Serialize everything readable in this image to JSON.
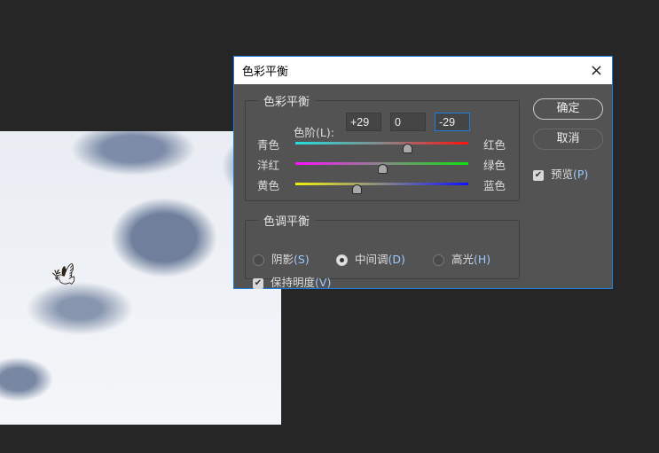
{
  "dialog": {
    "title": "色彩平衡",
    "close_icon": "×"
  },
  "color_balance": {
    "legend": "色彩平衡",
    "levels_label": "色阶",
    "levels_mnemonic": "(L):",
    "levels": [
      "+29",
      "0",
      "-29"
    ],
    "sliders": [
      {
        "left": "青色",
        "right": "红色",
        "value": 29,
        "from": "#20e0e0",
        "to": "#ff1010"
      },
      {
        "left": "洋红",
        "right": "绿色",
        "value": 0,
        "from": "#ff10ff",
        "to": "#10e010"
      },
      {
        "left": "黄色",
        "right": "蓝色",
        "value": -29,
        "from": "#f0f010",
        "to": "#1010ff"
      }
    ]
  },
  "tone_balance": {
    "legend": "色调平衡",
    "options": [
      {
        "label": "阴影",
        "mnemonic": "(S)",
        "selected": false
      },
      {
        "label": "中间调",
        "mnemonic": "(D)",
        "selected": true
      },
      {
        "label": "高光",
        "mnemonic": "(H)",
        "selected": false
      }
    ],
    "preserve_label": "保持明度",
    "preserve_mnemonic": "(V)",
    "preserve_checked": true
  },
  "buttons": {
    "ok": "确定",
    "cancel": "取消"
  },
  "preview": {
    "label": "预览",
    "mnemonic": "(P)",
    "checked": true
  }
}
